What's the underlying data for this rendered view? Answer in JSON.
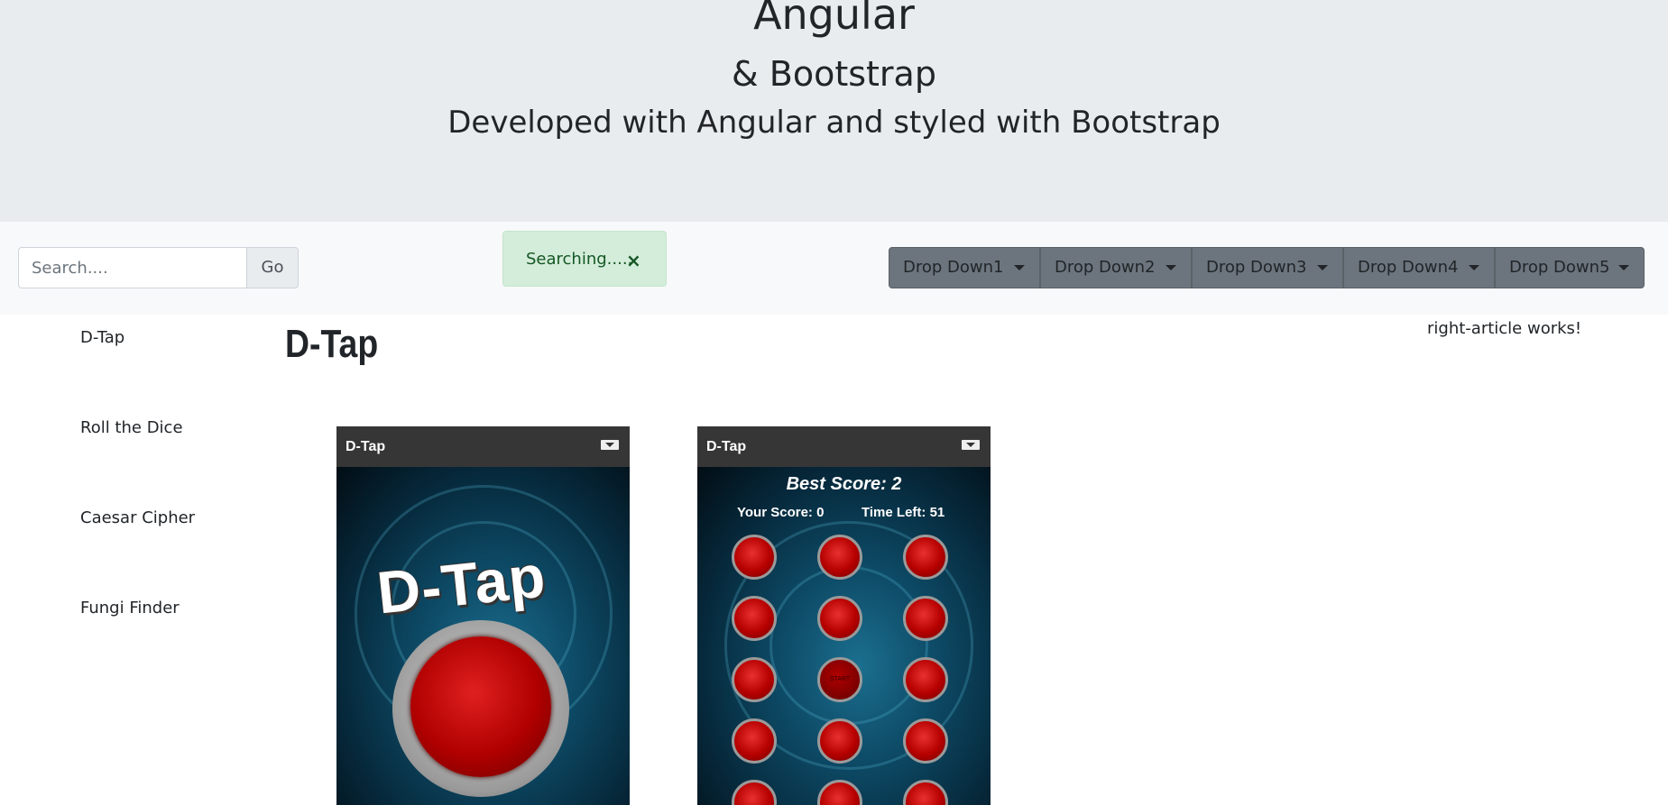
{
  "header": {
    "title": "Angular",
    "subtitle": "& Bootstrap",
    "lead": "Developed with Angular and styled with Bootstrap"
  },
  "toolbar": {
    "search_placeholder": "Search....",
    "go_label": "Go",
    "alert_text": "Searching.....",
    "close_glyph": "×",
    "dropdowns": [
      "Drop Down1",
      "Drop Down2",
      "Drop Down3",
      "Drop Down4",
      "Drop Down5"
    ]
  },
  "sidebar": {
    "items": [
      "D-Tap",
      "Roll the Dice",
      "Caesar Cipher",
      "Fungi Finder"
    ]
  },
  "main": {
    "title": "D-Tap",
    "right_article": "right-article works!"
  },
  "screenshots": {
    "left": {
      "app_title": "D-Tap",
      "logo_text": "D-Tap"
    },
    "right": {
      "app_title": "D-Tap",
      "best_score": "Best Score: 2",
      "your_score": "Your Score: 0",
      "time_left": "Time Left: 51",
      "start_label": "START"
    }
  },
  "colors": {
    "jumbotron_bg": "#e9ecef",
    "toolbar_bg": "#f8f9fa",
    "alert_bg": "#d4edda",
    "dropdown_bg": "#6c757d",
    "app_bar": "#363636"
  }
}
